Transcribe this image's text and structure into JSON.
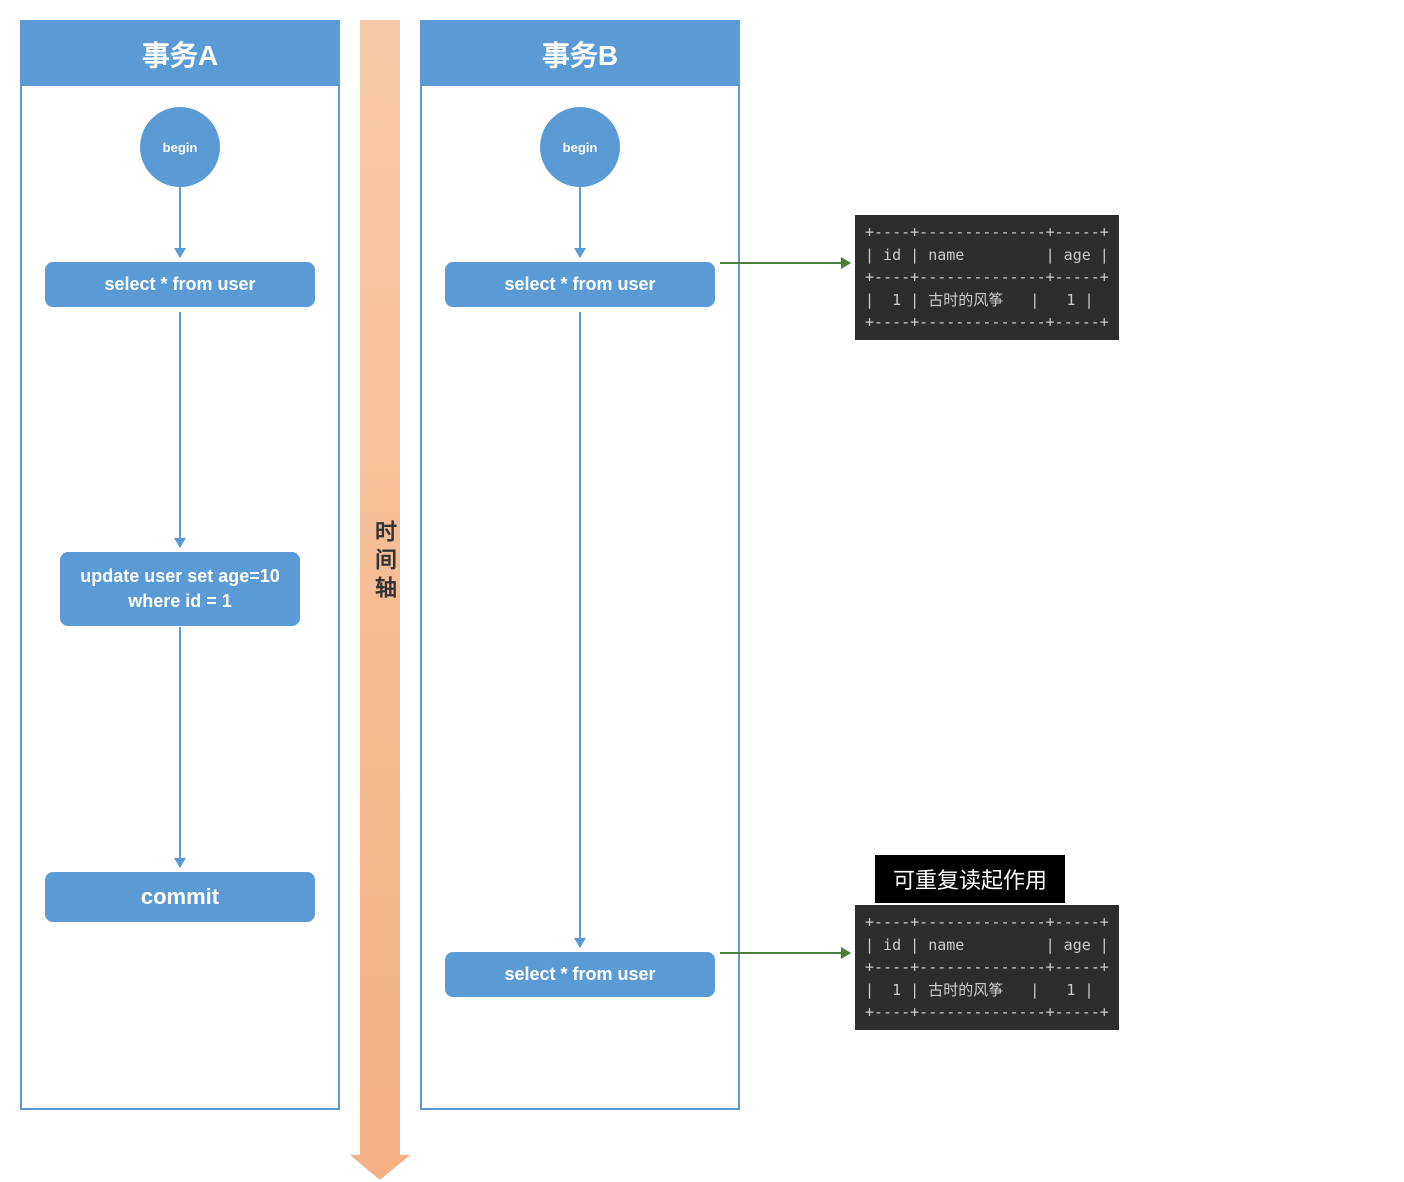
{
  "transactionA": {
    "title": "事务A",
    "begin": "begin",
    "step1": "select * from user",
    "step2": "update user set age=10 where id = 1",
    "step3": "commit"
  },
  "transactionB": {
    "title": "事务B",
    "begin": "begin",
    "step1": "select * from user",
    "step2": "select * from user"
  },
  "timeline": {
    "label": "时间轴"
  },
  "result1": {
    "border_top": "+----+--------------+-----+",
    "header": "| id | name         | age |",
    "border_mid": "+----+--------------+-----+",
    "row": "|  1 | 古时的风筝   |   1 |",
    "border_bot": "+----+--------------+-----+"
  },
  "result2": {
    "note": "可重复读起作用",
    "border_top": "+----+--------------+-----+",
    "header": "| id | name         | age |",
    "border_mid": "+----+--------------+-----+",
    "row": "|  1 | 古时的风筝   |   1 |",
    "border_bot": "+----+--------------+-----+"
  }
}
